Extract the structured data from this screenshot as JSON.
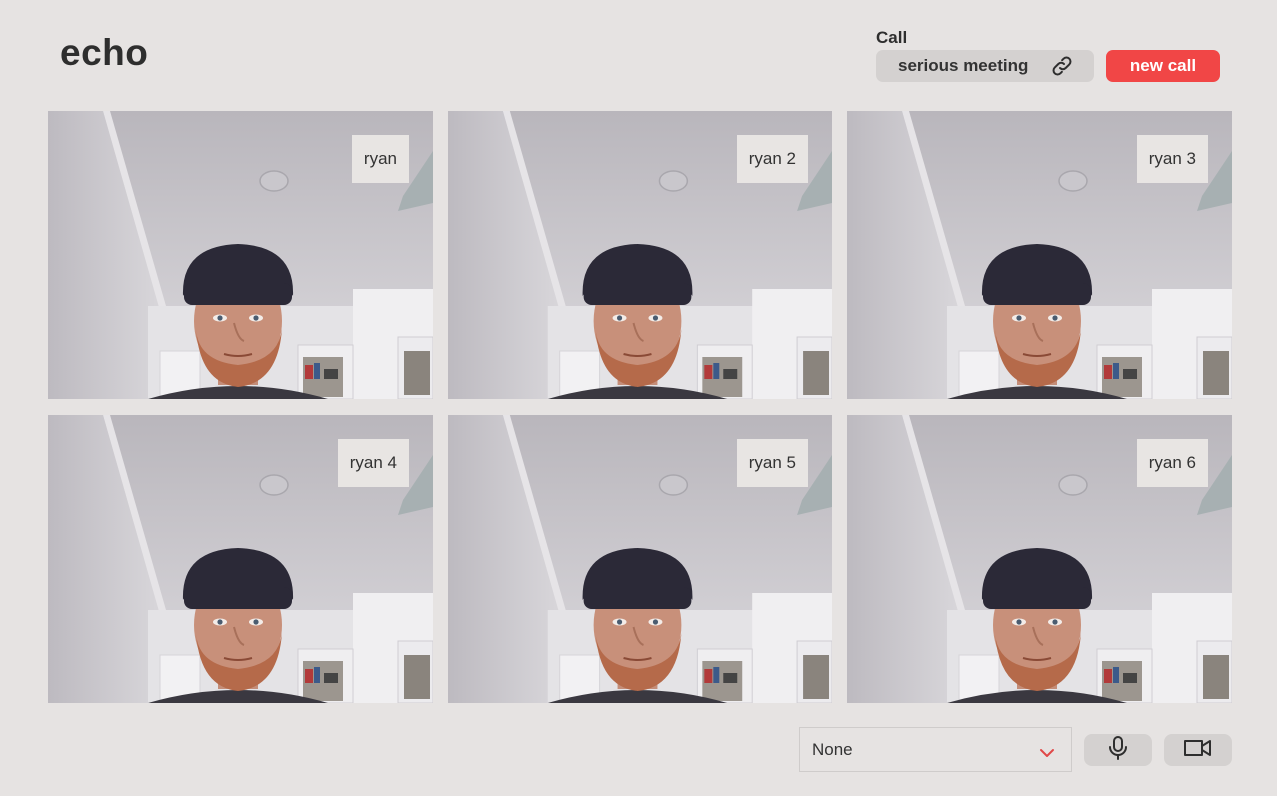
{
  "app": {
    "title": "echo"
  },
  "call": {
    "label": "Call",
    "meeting_name": "serious meeting",
    "link_icon": "link-icon",
    "new_call_label": "new call",
    "new_call_color": "#f14646"
  },
  "participants": [
    {
      "name": "ryan"
    },
    {
      "name": "ryan 2"
    },
    {
      "name": "ryan 3"
    },
    {
      "name": "ryan 4"
    },
    {
      "name": "ryan 5"
    },
    {
      "name": "ryan 6"
    }
  ],
  "controls": {
    "device_select_value": "None",
    "chevron_icon": "chevron-down-icon",
    "chevron_color": "#e04848",
    "mic_icon": "microphone-icon",
    "camera_icon": "video-camera-icon"
  }
}
